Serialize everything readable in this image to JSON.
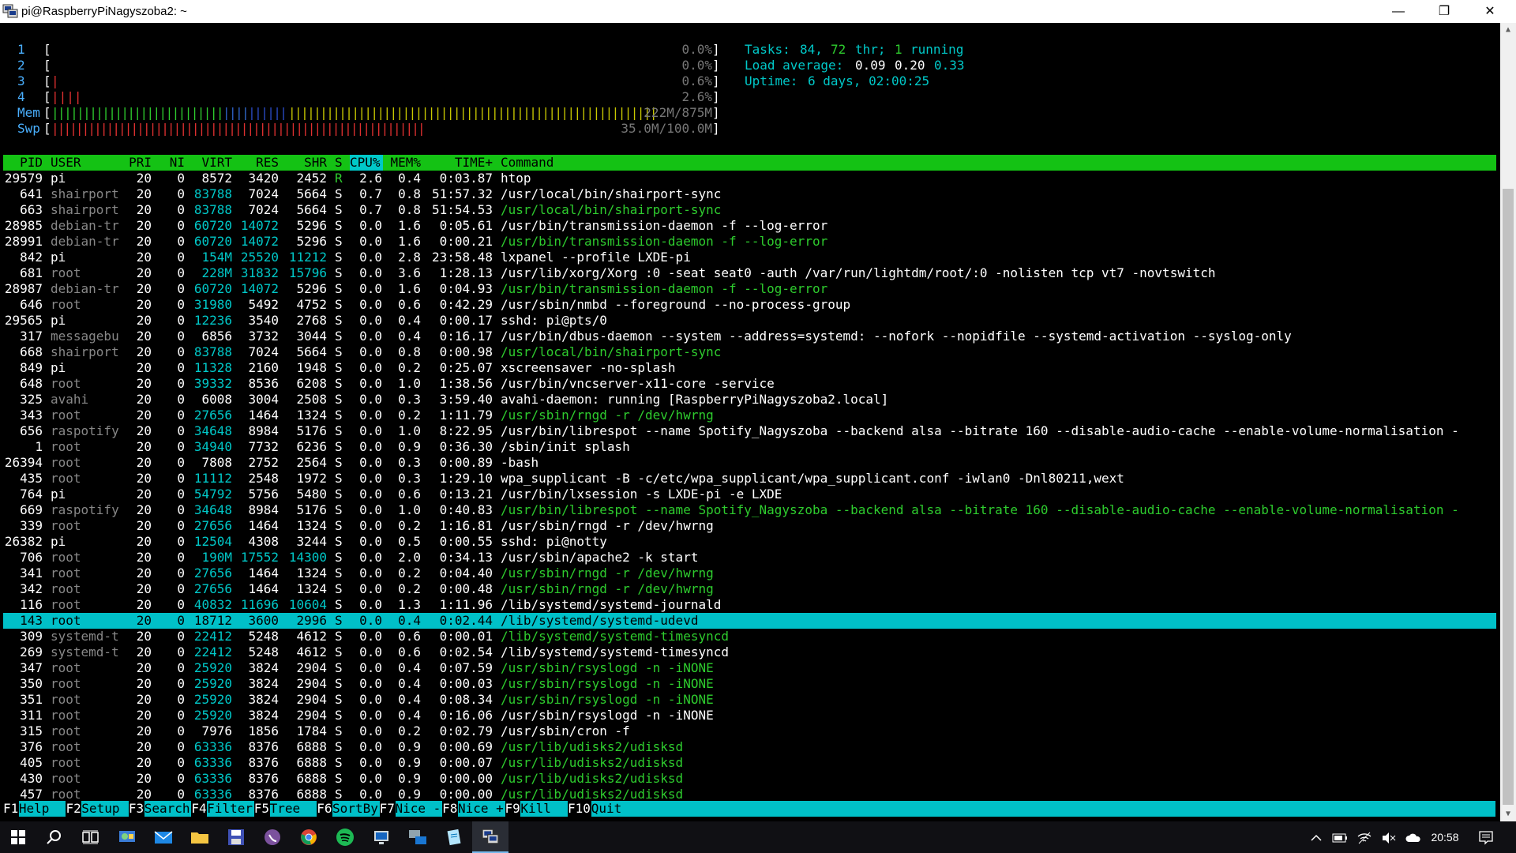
{
  "window": {
    "title": "pi@RaspberryPiNagyszoba2: ~",
    "minimize_glyph": "—",
    "maximize_glyph": "❐",
    "close_glyph": "✕"
  },
  "meters": {
    "cpu": [
      {
        "label": "1",
        "bar": "",
        "value": "0.0%"
      },
      {
        "label": "2",
        "bar": "",
        "value": "0.0%"
      },
      {
        "label": "3",
        "bar": "|",
        "value": "0.6%"
      },
      {
        "label": "4",
        "bar": "||||",
        "value": "2.6%"
      }
    ],
    "mem": {
      "label": "Mem",
      "bar_green": "|||||||||||||||||||||||||||||||",
      "bar_blue": "||||||||||",
      "bar_yellow": "||||||||||||||||||||||||||||||||||||||||||||||||||||||||||",
      "value": "222M/875M"
    },
    "swp": {
      "label": "Swp",
      "bar": "|||||||||||||||||||||||||||||||||||||||||||||||||||||||||||||",
      "value": "35.0M/100.0M"
    }
  },
  "summary": {
    "tasks_label": "Tasks:",
    "tasks_value": "84,",
    "thr_value": "72",
    "thr_label": "thr;",
    "running_value": "1",
    "running_label": "running",
    "load_label": "Load average:",
    "load_1": "0.09",
    "load_5": "0.20",
    "load_15": "0.33",
    "uptime_label": "Uptime:",
    "uptime_value": "6 days, 02:00:25"
  },
  "columns": [
    "PID",
    "USER",
    "PRI",
    "NI",
    "VIRT",
    "RES",
    "SHR",
    "S",
    "CPU%",
    "MEM%",
    "TIME+",
    "Command"
  ],
  "processes": [
    {
      "pid": "29579",
      "user": "pi",
      "pri": "20",
      "ni": "0",
      "virt": "8572",
      "res": "3420",
      "shr": "2452",
      "s": "R",
      "cpu": "2.6",
      "mem": "0.4",
      "time": "0:03.87",
      "cmd": "htop",
      "thread": false
    },
    {
      "pid": "641",
      "user": "shairport",
      "pri": "20",
      "ni": "0",
      "virt": "83788",
      "res": "7024",
      "shr": "5664",
      "s": "S",
      "cpu": "0.7",
      "mem": "0.8",
      "time": "51:57.32",
      "cmd": "/usr/local/bin/shairport-sync",
      "thread": false
    },
    {
      "pid": "663",
      "user": "shairport",
      "pri": "20",
      "ni": "0",
      "virt": "83788",
      "res": "7024",
      "shr": "5664",
      "s": "S",
      "cpu": "0.7",
      "mem": "0.8",
      "time": "51:54.53",
      "cmd": "/usr/local/bin/shairport-sync",
      "thread": true
    },
    {
      "pid": "28985",
      "user": "debian-tr",
      "pri": "20",
      "ni": "0",
      "virt": "60720",
      "res": "14072",
      "shr": "5296",
      "s": "S",
      "cpu": "0.0",
      "mem": "1.6",
      "time": "0:05.61",
      "cmd": "/usr/bin/transmission-daemon -f --log-error",
      "thread": false
    },
    {
      "pid": "28991",
      "user": "debian-tr",
      "pri": "20",
      "ni": "0",
      "virt": "60720",
      "res": "14072",
      "shr": "5296",
      "s": "S",
      "cpu": "0.0",
      "mem": "1.6",
      "time": "0:00.21",
      "cmd": "/usr/bin/transmission-daemon -f --log-error",
      "thread": true
    },
    {
      "pid": "842",
      "user": "pi",
      "pri": "20",
      "ni": "0",
      "virt": "154M",
      "res": "25520",
      "shr": "11212",
      "s": "S",
      "cpu": "0.0",
      "mem": "2.8",
      "time": "23:58.48",
      "cmd": "lxpanel --profile LXDE-pi",
      "thread": false
    },
    {
      "pid": "681",
      "user": "root",
      "pri": "20",
      "ni": "0",
      "virt": "228M",
      "res": "31832",
      "shr": "15796",
      "s": "S",
      "cpu": "0.0",
      "mem": "3.6",
      "time": "1:28.13",
      "cmd": "/usr/lib/xorg/Xorg :0 -seat seat0 -auth /var/run/lightdm/root/:0 -nolisten tcp vt7 -novtswitch",
      "thread": false
    },
    {
      "pid": "28987",
      "user": "debian-tr",
      "pri": "20",
      "ni": "0",
      "virt": "60720",
      "res": "14072",
      "shr": "5296",
      "s": "S",
      "cpu": "0.0",
      "mem": "1.6",
      "time": "0:04.93",
      "cmd": "/usr/bin/transmission-daemon -f --log-error",
      "thread": true
    },
    {
      "pid": "646",
      "user": "root",
      "pri": "20",
      "ni": "0",
      "virt": "31980",
      "res": "5492",
      "shr": "4752",
      "s": "S",
      "cpu": "0.0",
      "mem": "0.6",
      "time": "0:42.29",
      "cmd": "/usr/sbin/nmbd --foreground --no-process-group",
      "thread": false
    },
    {
      "pid": "29565",
      "user": "pi",
      "pri": "20",
      "ni": "0",
      "virt": "12236",
      "res": "3540",
      "shr": "2768",
      "s": "S",
      "cpu": "0.0",
      "mem": "0.4",
      "time": "0:00.17",
      "cmd": "sshd: pi@pts/0",
      "thread": false
    },
    {
      "pid": "317",
      "user": "messagebu",
      "pri": "20",
      "ni": "0",
      "virt": "6856",
      "res": "3732",
      "shr": "3044",
      "s": "S",
      "cpu": "0.0",
      "mem": "0.4",
      "time": "0:16.17",
      "cmd": "/usr/bin/dbus-daemon --system --address=systemd: --nofork --nopidfile --systemd-activation --syslog-only",
      "thread": false
    },
    {
      "pid": "668",
      "user": "shairport",
      "pri": "20",
      "ni": "0",
      "virt": "83788",
      "res": "7024",
      "shr": "5664",
      "s": "S",
      "cpu": "0.0",
      "mem": "0.8",
      "time": "0:00.98",
      "cmd": "/usr/local/bin/shairport-sync",
      "thread": true
    },
    {
      "pid": "849",
      "user": "pi",
      "pri": "20",
      "ni": "0",
      "virt": "11328",
      "res": "2160",
      "shr": "1948",
      "s": "S",
      "cpu": "0.0",
      "mem": "0.2",
      "time": "0:25.07",
      "cmd": "xscreensaver -no-splash",
      "thread": false
    },
    {
      "pid": "648",
      "user": "root",
      "pri": "20",
      "ni": "0",
      "virt": "39332",
      "res": "8536",
      "shr": "6208",
      "s": "S",
      "cpu": "0.0",
      "mem": "1.0",
      "time": "1:38.56",
      "cmd": "/usr/bin/vncserver-x11-core -service",
      "thread": false
    },
    {
      "pid": "325",
      "user": "avahi",
      "pri": "20",
      "ni": "0",
      "virt": "6008",
      "res": "3004",
      "shr": "2508",
      "s": "S",
      "cpu": "0.0",
      "mem": "0.3",
      "time": "3:59.40",
      "cmd": "avahi-daemon: running [RaspberryPiNagyszoba2.local]",
      "thread": false
    },
    {
      "pid": "343",
      "user": "root",
      "pri": "20",
      "ni": "0",
      "virt": "27656",
      "res": "1464",
      "shr": "1324",
      "s": "S",
      "cpu": "0.0",
      "mem": "0.2",
      "time": "1:11.79",
      "cmd": "/usr/sbin/rngd -r /dev/hwrng",
      "thread": true
    },
    {
      "pid": "656",
      "user": "raspotify",
      "pri": "20",
      "ni": "0",
      "virt": "34648",
      "res": "8984",
      "shr": "5176",
      "s": "S",
      "cpu": "0.0",
      "mem": "1.0",
      "time": "8:22.95",
      "cmd": "/usr/bin/librespot --name Spotify_Nagyszoba --backend alsa --bitrate 160 --disable-audio-cache --enable-volume-normalisation -",
      "thread": false
    },
    {
      "pid": "1",
      "user": "root",
      "pri": "20",
      "ni": "0",
      "virt": "34940",
      "res": "7732",
      "shr": "6236",
      "s": "S",
      "cpu": "0.0",
      "mem": "0.9",
      "time": "0:36.30",
      "cmd": "/sbin/init splash",
      "thread": false
    },
    {
      "pid": "26394",
      "user": "root",
      "pri": "20",
      "ni": "0",
      "virt": "7808",
      "res": "2752",
      "shr": "2564",
      "s": "S",
      "cpu": "0.0",
      "mem": "0.3",
      "time": "0:00.89",
      "cmd": "-bash",
      "thread": false
    },
    {
      "pid": "435",
      "user": "root",
      "pri": "20",
      "ni": "0",
      "virt": "11112",
      "res": "2548",
      "shr": "1972",
      "s": "S",
      "cpu": "0.0",
      "mem": "0.3",
      "time": "1:29.10",
      "cmd": "wpa_supplicant -B -c/etc/wpa_supplicant/wpa_supplicant.conf -iwlan0 -Dnl80211,wext",
      "thread": false
    },
    {
      "pid": "764",
      "user": "pi",
      "pri": "20",
      "ni": "0",
      "virt": "54792",
      "res": "5756",
      "shr": "5480",
      "s": "S",
      "cpu": "0.0",
      "mem": "0.6",
      "time": "0:13.21",
      "cmd": "/usr/bin/lxsession -s LXDE-pi -e LXDE",
      "thread": false
    },
    {
      "pid": "669",
      "user": "raspotify",
      "pri": "20",
      "ni": "0",
      "virt": "34648",
      "res": "8984",
      "shr": "5176",
      "s": "S",
      "cpu": "0.0",
      "mem": "1.0",
      "time": "0:40.83",
      "cmd": "/usr/bin/librespot --name Spotify_Nagyszoba --backend alsa --bitrate 160 --disable-audio-cache --enable-volume-normalisation -",
      "thread": true
    },
    {
      "pid": "339",
      "user": "root",
      "pri": "20",
      "ni": "0",
      "virt": "27656",
      "res": "1464",
      "shr": "1324",
      "s": "S",
      "cpu": "0.0",
      "mem": "0.2",
      "time": "1:16.81",
      "cmd": "/usr/sbin/rngd -r /dev/hwrng",
      "thread": false
    },
    {
      "pid": "26382",
      "user": "pi",
      "pri": "20",
      "ni": "0",
      "virt": "12504",
      "res": "4308",
      "shr": "3244",
      "s": "S",
      "cpu": "0.0",
      "mem": "0.5",
      "time": "0:00.55",
      "cmd": "sshd: pi@notty",
      "thread": false
    },
    {
      "pid": "706",
      "user": "root",
      "pri": "20",
      "ni": "0",
      "virt": "190M",
      "res": "17552",
      "shr": "14300",
      "s": "S",
      "cpu": "0.0",
      "mem": "2.0",
      "time": "0:34.13",
      "cmd": "/usr/sbin/apache2 -k start",
      "thread": false
    },
    {
      "pid": "341",
      "user": "root",
      "pri": "20",
      "ni": "0",
      "virt": "27656",
      "res": "1464",
      "shr": "1324",
      "s": "S",
      "cpu": "0.0",
      "mem": "0.2",
      "time": "0:04.40",
      "cmd": "/usr/sbin/rngd -r /dev/hwrng",
      "thread": true
    },
    {
      "pid": "342",
      "user": "root",
      "pri": "20",
      "ni": "0",
      "virt": "27656",
      "res": "1464",
      "shr": "1324",
      "s": "S",
      "cpu": "0.0",
      "mem": "0.2",
      "time": "0:00.48",
      "cmd": "/usr/sbin/rngd -r /dev/hwrng",
      "thread": true
    },
    {
      "pid": "116",
      "user": "root",
      "pri": "20",
      "ni": "0",
      "virt": "40832",
      "res": "11696",
      "shr": "10604",
      "s": "S",
      "cpu": "0.0",
      "mem": "1.3",
      "time": "1:11.96",
      "cmd": "/lib/systemd/systemd-journald",
      "thread": false
    },
    {
      "pid": "143",
      "user": "root",
      "pri": "20",
      "ni": "0",
      "virt": "18712",
      "res": "3600",
      "shr": "2996",
      "s": "S",
      "cpu": "0.0",
      "mem": "0.4",
      "time": "0:02.44",
      "cmd": "/lib/systemd/systemd-udevd",
      "thread": false,
      "selected": true
    },
    {
      "pid": "309",
      "user": "systemd-t",
      "pri": "20",
      "ni": "0",
      "virt": "22412",
      "res": "5248",
      "shr": "4612",
      "s": "S",
      "cpu": "0.0",
      "mem": "0.6",
      "time": "0:00.01",
      "cmd": "/lib/systemd/systemd-timesyncd",
      "thread": true
    },
    {
      "pid": "269",
      "user": "systemd-t",
      "pri": "20",
      "ni": "0",
      "virt": "22412",
      "res": "5248",
      "shr": "4612",
      "s": "S",
      "cpu": "0.0",
      "mem": "0.6",
      "time": "0:02.54",
      "cmd": "/lib/systemd/systemd-timesyncd",
      "thread": false
    },
    {
      "pid": "347",
      "user": "root",
      "pri": "20",
      "ni": "0",
      "virt": "25920",
      "res": "3824",
      "shr": "2904",
      "s": "S",
      "cpu": "0.0",
      "mem": "0.4",
      "time": "0:07.59",
      "cmd": "/usr/sbin/rsyslogd -n -iNONE",
      "thread": true
    },
    {
      "pid": "350",
      "user": "root",
      "pri": "20",
      "ni": "0",
      "virt": "25920",
      "res": "3824",
      "shr": "2904",
      "s": "S",
      "cpu": "0.0",
      "mem": "0.4",
      "time": "0:00.03",
      "cmd": "/usr/sbin/rsyslogd -n -iNONE",
      "thread": true
    },
    {
      "pid": "351",
      "user": "root",
      "pri": "20",
      "ni": "0",
      "virt": "25920",
      "res": "3824",
      "shr": "2904",
      "s": "S",
      "cpu": "0.0",
      "mem": "0.4",
      "time": "0:08.34",
      "cmd": "/usr/sbin/rsyslogd -n -iNONE",
      "thread": true
    },
    {
      "pid": "311",
      "user": "root",
      "pri": "20",
      "ni": "0",
      "virt": "25920",
      "res": "3824",
      "shr": "2904",
      "s": "S",
      "cpu": "0.0",
      "mem": "0.4",
      "time": "0:16.06",
      "cmd": "/usr/sbin/rsyslogd -n -iNONE",
      "thread": false
    },
    {
      "pid": "315",
      "user": "root",
      "pri": "20",
      "ni": "0",
      "virt": "7976",
      "res": "1856",
      "shr": "1784",
      "s": "S",
      "cpu": "0.0",
      "mem": "0.2",
      "time": "0:02.79",
      "cmd": "/usr/sbin/cron -f",
      "thread": false
    },
    {
      "pid": "376",
      "user": "root",
      "pri": "20",
      "ni": "0",
      "virt": "63336",
      "res": "8376",
      "shr": "6888",
      "s": "S",
      "cpu": "0.0",
      "mem": "0.9",
      "time": "0:00.69",
      "cmd": "/usr/lib/udisks2/udisksd",
      "thread": true
    },
    {
      "pid": "405",
      "user": "root",
      "pri": "20",
      "ni": "0",
      "virt": "63336",
      "res": "8376",
      "shr": "6888",
      "s": "S",
      "cpu": "0.0",
      "mem": "0.9",
      "time": "0:00.07",
      "cmd": "/usr/lib/udisks2/udisksd",
      "thread": true
    },
    {
      "pid": "430",
      "user": "root",
      "pri": "20",
      "ni": "0",
      "virt": "63336",
      "res": "8376",
      "shr": "6888",
      "s": "S",
      "cpu": "0.0",
      "mem": "0.9",
      "time": "0:00.00",
      "cmd": "/usr/lib/udisks2/udisksd",
      "thread": true
    },
    {
      "pid": "457",
      "user": "root",
      "pri": "20",
      "ni": "0",
      "virt": "63336",
      "res": "8376",
      "shr": "6888",
      "s": "S",
      "cpu": "0.0",
      "mem": "0.9",
      "time": "0:00.00",
      "cmd": "/usr/lib/udisks2/udisksd",
      "thread": true
    }
  ],
  "function_keys": [
    {
      "key": "F1",
      "label": "Help  "
    },
    {
      "key": "F2",
      "label": "Setup "
    },
    {
      "key": "F3",
      "label": "Search"
    },
    {
      "key": "F4",
      "label": "Filter"
    },
    {
      "key": "F5",
      "label": "Tree  "
    },
    {
      "key": "F6",
      "label": "SortBy"
    },
    {
      "key": "F7",
      "label": "Nice -"
    },
    {
      "key": "F8",
      "label": "Nice +"
    },
    {
      "key": "F9",
      "label": "Kill  "
    },
    {
      "key": "F10",
      "label": "Quit  "
    }
  ],
  "taskbar": {
    "apps": [
      "start-icon",
      "search-icon",
      "task-view-icon",
      "control-panel-icon",
      "mail-icon",
      "file-explorer-icon",
      "save-disk-icon",
      "viber-icon",
      "chrome-icon",
      "spotify-icon",
      "remote-desktop-icon",
      "network-app-icon",
      "notepad-icon",
      "putty-icon"
    ],
    "clock": "20:58"
  },
  "colors": {
    "header_green": "#14c214",
    "selection_cyan": "#00c0c8",
    "thread_green": "#2ecc2e",
    "meter_teal": "#00c8c8"
  }
}
